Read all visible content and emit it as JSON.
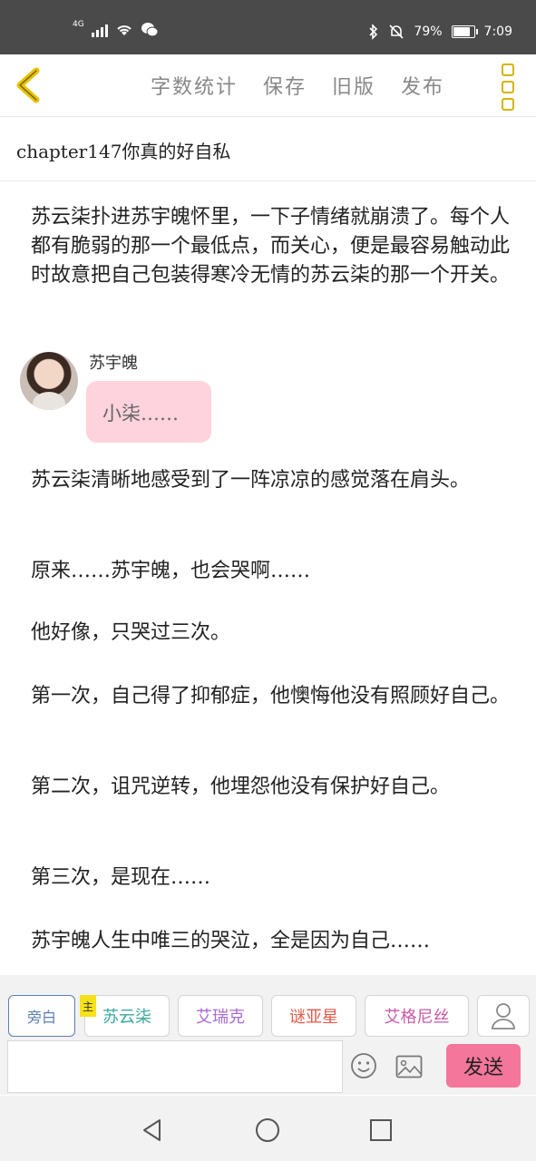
{
  "status_bar": {
    "network": "4G",
    "battery": "79%",
    "time": "7:09"
  },
  "header": {
    "actions": [
      "字数统计",
      "保存",
      "旧版",
      "发布"
    ]
  },
  "chapter": {
    "title": "chapter147你真的好自私"
  },
  "content": {
    "para1": "苏云柒扑进苏宇魄怀里，一下子情绪就崩溃了。每个人都有脆弱的那一个最低点，而关心，便是最容易触动此时故意把自己包装得寒冷无情的苏云柒的那一个开关。",
    "dialog": {
      "speaker": "苏宇魄",
      "text": "小柒……"
    },
    "paragraphs": [
      "苏云柒清晰地感受到了一阵凉凉的感觉落在肩头。",
      "原来……苏宇魄，也会哭啊……",
      "他好像，只哭过三次。",
      "第一次，自己得了抑郁症，他懊悔他没有照顾好自己。",
      "第二次，诅咒逆转，他埋怨他没有保护好自己。",
      "第三次，是现在……",
      "苏宇魄人生中唯三的哭泣，全是因为自己……"
    ]
  },
  "characters": {
    "narration": "旁白",
    "main_tag": "主",
    "list": [
      {
        "name": "苏云柒",
        "color": "#3aa8a0"
      },
      {
        "name": "艾瑞克",
        "color": "#a86bd0"
      },
      {
        "name": "谜亚星",
        "color": "#e05a4a"
      },
      {
        "name": "艾格尼丝",
        "color": "#c85aa8"
      }
    ]
  },
  "composer": {
    "send_label": "发送"
  },
  "colors": {
    "accent_pink": "#f4769b",
    "bubble_pink": "#ffd3dd",
    "menu_yellow": "#d6b400"
  }
}
